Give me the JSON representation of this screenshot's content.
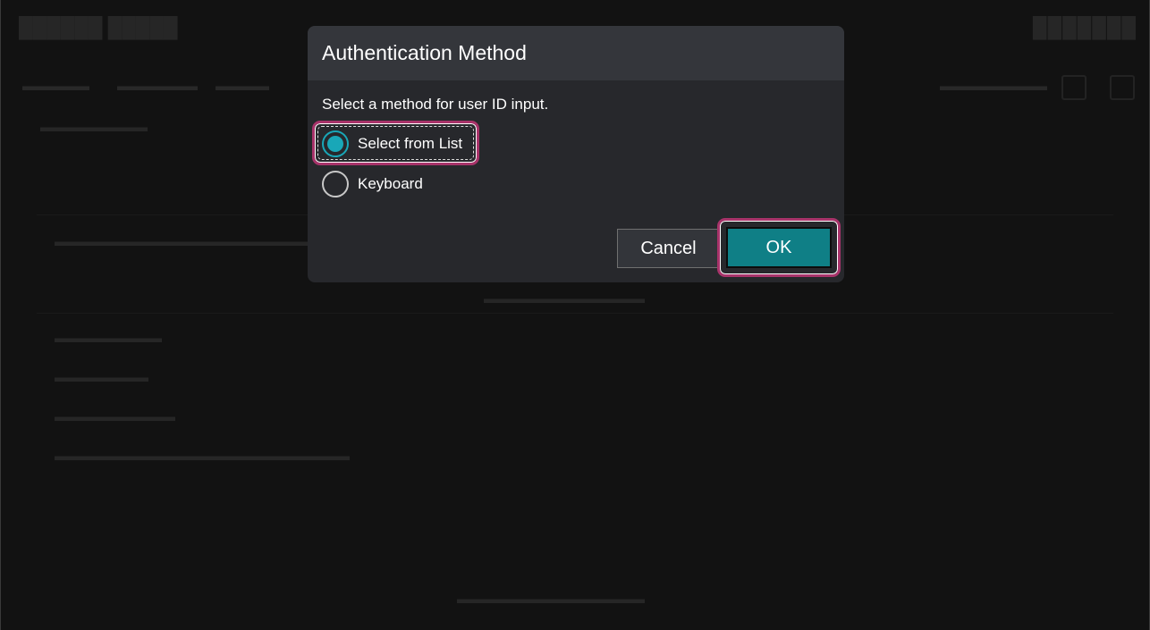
{
  "dialog": {
    "title": "Authentication Method",
    "prompt": "Select a method for user ID input.",
    "options": [
      {
        "label": "Select from List",
        "selected": true
      },
      {
        "label": "Keyboard",
        "selected": false
      }
    ],
    "cancel_label": "Cancel",
    "ok_label": "OK"
  },
  "colors": {
    "accent": "#19a7b8",
    "primary_button": "#0f7f86",
    "focus_ring": "#a8336a",
    "dialog_bg": "#27282c",
    "header_bg": "#34363b"
  }
}
